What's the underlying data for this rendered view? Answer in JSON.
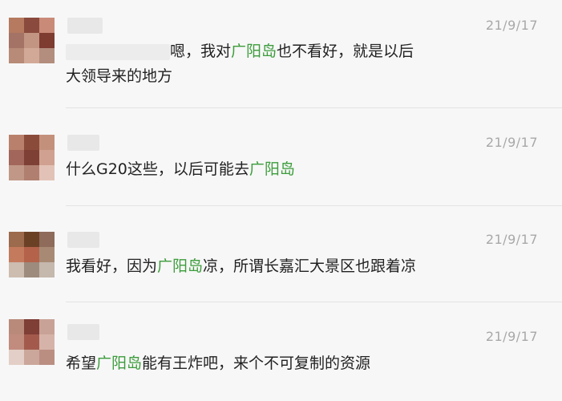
{
  "comments": [
    {
      "date": "21/9/17",
      "line1": {
        "a": "嗯，我对",
        "h": "广阳岛",
        "b": "也不看好，就是以后"
      },
      "line2": "大领导来的地方",
      "avatar_colors": [
        "#b57a5f",
        "#8a4a3d",
        "#c98a78",
        "#a57266",
        "#c29583",
        "#7e3b30",
        "#b78b78",
        "#d2a997",
        "#b38d7e"
      ]
    },
    {
      "date": "21/9/17",
      "line1": {
        "a": "什么G20这些，以后可能去",
        "h": "广阳岛",
        "b": ""
      },
      "avatar_colors": [
        "#b9816c",
        "#8b4b3b",
        "#c3907c",
        "#a2665a",
        "#7e4034",
        "#d0a190",
        "#c19887",
        "#b07f6f",
        "#e2c2b6"
      ]
    },
    {
      "date": "21/9/17",
      "line1": {
        "a": "我看好，因为",
        "h": "广阳岛",
        "b": "凉，所谓长嘉汇大景区也跟着凉"
      },
      "avatar_colors": [
        "#9c6a4c",
        "#6b4126",
        "#8e6b5b",
        "#c47a5d",
        "#b4624a",
        "#a88a74",
        "#cdbcb0",
        "#9d8b7d",
        "#c5b8ad"
      ]
    },
    {
      "date": "21/9/17",
      "line1": {
        "a": "希望",
        "h": "广阳岛",
        "b": "能有王炸吧，来个不可复制的资源"
      },
      "avatar_colors": [
        "#b98a7a",
        "#7f3e36",
        "#c9a297",
        "#c18c7e",
        "#a35a4c",
        "#d6b3a8",
        "#e3cfc7",
        "#cba79b",
        "#bb8e82"
      ]
    }
  ]
}
